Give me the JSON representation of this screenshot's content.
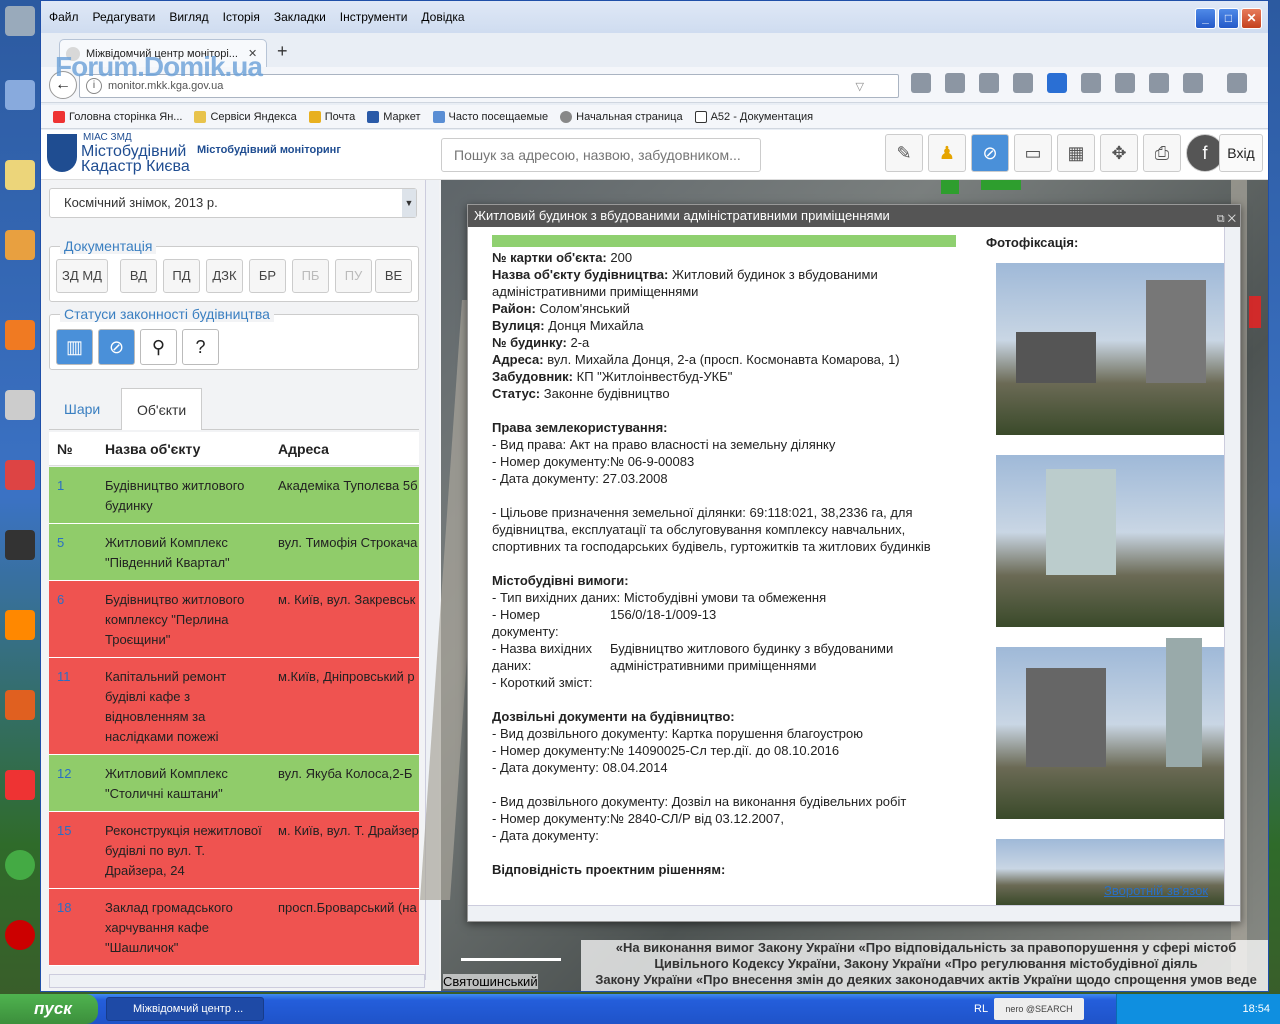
{
  "browser": {
    "menu": [
      "Файл",
      "Редагувати",
      "Вигляд",
      "Історія",
      "Закладки",
      "Інструменти",
      "Довідка"
    ],
    "tab_title": "Міжвідомчий центр моніторі...",
    "url": "monitor.mkk.kga.gov.ua",
    "watermark": "Forum.Domik.ua",
    "bookmarks": [
      "Головна сторінка Ян...",
      "Сервіси Яндекса",
      "Почта",
      "Маркет",
      "Часто посещаемые",
      "Начальная страница",
      "A52 - Документация"
    ]
  },
  "app": {
    "logo_top": "МІАС ЗМД",
    "logo_line1": "Містобудівний",
    "logo_line2": "Кадастр Києва",
    "logo_sub": "Містобудівний моніторинг",
    "search_placeholder": "Пошук за адресою, назвою, забудовником...",
    "exit_label": "Вхід"
  },
  "sidebar": {
    "layer_select": "Космічний знімок, 2013 р.",
    "doc_legend": "Документація",
    "doc_buttons": [
      "ЗД МД",
      "ВД",
      "ПД",
      "ДЗК",
      "БР",
      "ПБ",
      "ПУ",
      "ВЕ"
    ],
    "status_legend": "Статуси законності будівництва",
    "tabs": [
      "Шари",
      "Об'єкти"
    ],
    "headers": [
      "№",
      "Назва об'єкту",
      "Адреса"
    ],
    "rows": [
      {
        "n": "1",
        "name": "Будівництво житлового будинку",
        "addr": "Академіка Туполєва 5б",
        "status": "green"
      },
      {
        "n": "5",
        "name": "Житловий Комплекс \"Південний Квартал\"",
        "addr": "вул. Тимофія Строкача",
        "status": "green"
      },
      {
        "n": "6",
        "name": "Будівництво житлового комплексу \"Перлина Троєщини\"",
        "addr": "м. Київ, вул. Закревськ",
        "status": "red"
      },
      {
        "n": "11",
        "name": "Капітальний ремонт будівлі кафе з відновленням за наслідками пожежі",
        "addr": "м.Київ, Дніпровський р вул.Сулеймана Стальс",
        "status": "red"
      },
      {
        "n": "12",
        "name": "Житловий Комплекс \"Столичні каштани\"",
        "addr": "вул. Якуба Колоса,2-Б",
        "status": "green"
      },
      {
        "n": "15",
        "name": "Реконструкція нежитлової будівлі по вул. Т. Драйзера, 24",
        "addr": "м. Київ, вул. Т. Драйзер",
        "status": "red"
      },
      {
        "n": "18",
        "name": "Заклад громадського харчування кафе \"Шашличок\"",
        "addr": "просп.Броварський (на птахофабрики)",
        "status": "red"
      }
    ]
  },
  "popup": {
    "title": "Житловий будинок з вбудованими адміністративними приміщеннями",
    "photos_label": "Фотофіксація:",
    "feedback": "Зворотній зв'язок",
    "card_no_label": "№ картки об'єкта:",
    "card_no": "200",
    "name_label": "Назва об'єкту будівництва:",
    "name": "Житловий будинок з вбудованими адміністративними приміщеннями",
    "district_label": "Район:",
    "district": "Солом'янський",
    "street_label": "Вулиця:",
    "street": "Донця Михайла",
    "house_label": "№ будинку:",
    "house": "2-а",
    "address_label": "Адреса:",
    "address": "вул. Михайла Донця, 2-а (просп. Космонавта Комарова, 1)",
    "builder_label": "Забудовник:",
    "builder": "КП \"Житлоінвестбуд-УКБ\"",
    "status_label": "Статус:",
    "status": "Законне будівництво",
    "land_h": "Права землекористування:",
    "land_1": "- Вид права: Акт на право власності на земельну ділянку",
    "land_2": "- Номер документу:№ 06-9-00083",
    "land_3": "- Дата документу:  27.03.2008",
    "land_4": "- Цільове призначення земельної ділянки: 69:118:021, 38,2336 га, для будівництва, експлуатації та обслуговування комплексу навчальних, спортивних та господарських будівель, гуртожитків та житлових будинків",
    "req_h": "Містобудівні вимоги:",
    "req_1": "- Тип вихідних даних: Містобудівні умови та обмеження",
    "req_2k": "- Номер документу:",
    "req_2v": "156/0/18-1/009-13",
    "req_3k": "- Назва вихідних даних:",
    "req_3v": "Будівництво житлового будинку з вбудованими адміністративними приміщеннями",
    "req_4": "- Короткий зміст:",
    "perm_h": "Дозвільні документи на будівництво:",
    "perm_1": "- Вид дозвільного документу: Картка порушення благоустрою",
    "perm_2": "- Номер документу:№ 14090025-Сл тер.дії. до 08.10.2016",
    "perm_3": "- Дата документу:  08.04.2014",
    "perm_4": "- Вид дозвільного документу: Дозвіл на виконання будівельних робіт",
    "perm_5": "- Номер документу:№ 2840-СЛ/Р від 03.12.2007,",
    "perm_6": "- Дата документу:",
    "proj_h": "Відповідність проектним рішенням:"
  },
  "map": {
    "footer_1": "«На виконання вимог Закону України «Про відповідальність за правопорушення у сфері містоб",
    "footer_2": "Цивільного Кодексу України, Закону України «Про регулювання містобудівної діяль",
    "footer_3": "Закону України «Про внесення змін до деяких законодавчих актів України щодо спрощення умов веде",
    "place": "Святошинський"
  },
  "taskbar": {
    "start": "пуск",
    "task": "Міжвідомчий центр ...",
    "lang": "RL",
    "nero": "nero @SEARCH",
    "clock": "18:54"
  },
  "colors": {
    "green_row": "#90cc6a",
    "red_row": "#ef5350",
    "accent": "#4a90d9"
  }
}
